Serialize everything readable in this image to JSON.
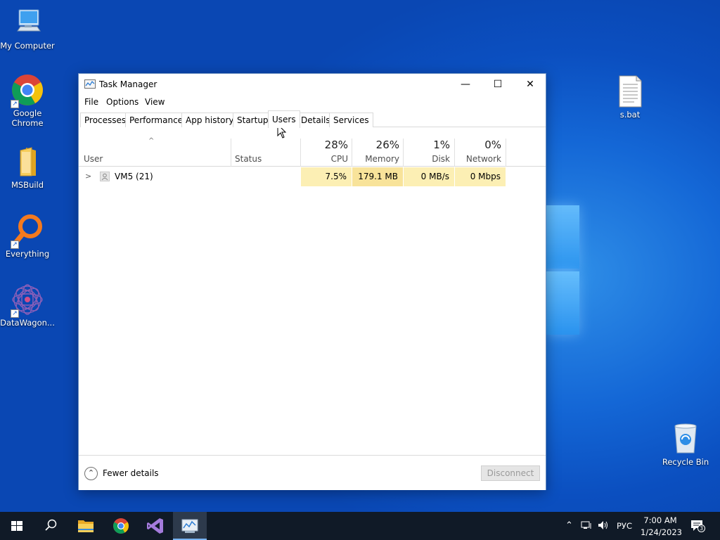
{
  "desktop": {
    "icons": [
      {
        "label": "My Computer",
        "icon": "computer-icon"
      },
      {
        "label": "Google Chrome",
        "icon": "chrome-icon"
      },
      {
        "label": "MSBuild",
        "icon": "folder-icon"
      },
      {
        "label": "Everything",
        "icon": "search-magnifier-icon"
      },
      {
        "label": "DataWagon...",
        "icon": "datawagon-icon"
      },
      {
        "label": "s.bat",
        "icon": "batch-file-icon"
      },
      {
        "label": "Recycle Bin",
        "icon": "recycle-bin-icon"
      }
    ]
  },
  "window": {
    "title": "Task Manager",
    "controls": {
      "minimize": "—",
      "maximize": "☐",
      "close": "✕"
    },
    "menu": [
      "File",
      "Options",
      "View"
    ],
    "tabs": [
      "Processes",
      "Performance",
      "App history",
      "Startup",
      "Users",
      "Details",
      "Services"
    ],
    "active_tab": "Users",
    "columns": {
      "user": "User",
      "status": "Status",
      "cpu": {
        "pct": "28%",
        "label": "CPU"
      },
      "memory": {
        "pct": "26%",
        "label": "Memory"
      },
      "disk": {
        "pct": "1%",
        "label": "Disk"
      },
      "network": {
        "pct": "0%",
        "label": "Network"
      }
    },
    "rows": [
      {
        "user": "VM5 (21)",
        "status": "",
        "cpu": "7.5%",
        "memory": "179.1 MB",
        "disk": "0 MB/s",
        "network": "0 Mbps"
      }
    ],
    "footer": {
      "fewer_details": "Fewer details",
      "disconnect": "Disconnect"
    }
  },
  "taskbar": {
    "pinned": [
      "windows-start-icon",
      "search-icon",
      "file-explorer-icon",
      "chrome-icon",
      "visual-studio-icon",
      "task-manager-icon"
    ],
    "language": "РУС",
    "time": "7:00 AM",
    "date": "1/24/2023",
    "notifications_count": "3"
  },
  "colors": {
    "accent": "#0078d7",
    "heat_light": "#fcefb4",
    "heat_dark": "#f8e39a"
  }
}
